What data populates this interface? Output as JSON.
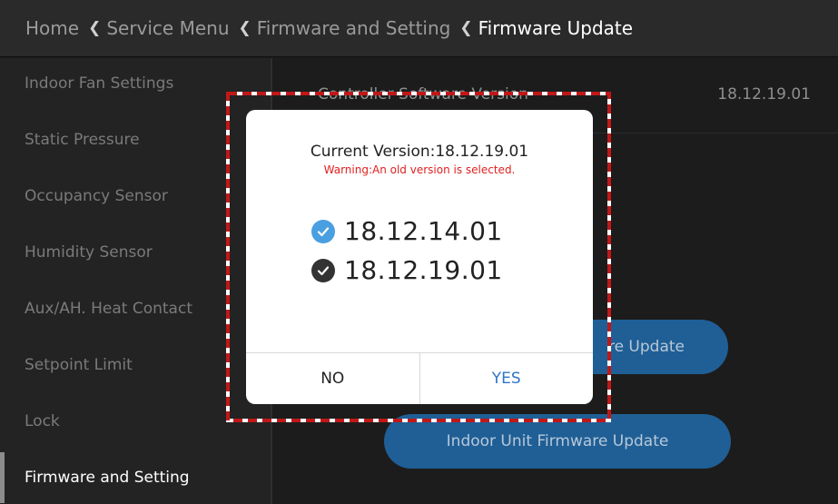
{
  "breadcrumb": [
    {
      "label": "Home"
    },
    {
      "label": "Service Menu"
    },
    {
      "label": "Firmware and Setting"
    },
    {
      "label": "Firmware Update"
    }
  ],
  "sidebar": {
    "items": [
      {
        "label": "Indoor Fan Settings"
      },
      {
        "label": "Static Pressure"
      },
      {
        "label": "Occupancy Sensor"
      },
      {
        "label": "Humidity Sensor"
      },
      {
        "label": "Aux/AH. Heat Contact"
      },
      {
        "label": "Setpoint Limit"
      },
      {
        "label": "Lock"
      },
      {
        "label": "Firmware and Setting"
      }
    ],
    "active_index": 7
  },
  "main": {
    "controller_label": "Controller Software Version",
    "controller_value": "18.12.19.01",
    "firmware_update_button": "re Update",
    "indoor_unit_button": "Indoor Unit Firmware Update"
  },
  "dialog": {
    "title": "Current Version:18.12.19.01",
    "warning": "Warning:An old version is selected.",
    "versions": [
      {
        "label": "18.12.14.01",
        "selected": true
      },
      {
        "label": "18.12.19.01",
        "selected": false
      }
    ],
    "no_label": "NO",
    "yes_label": "YES"
  },
  "colors": {
    "selected_check": "#4a9fe0",
    "unselected_check": "#333333",
    "warning": "#e02020",
    "yes": "#2f74c8",
    "pill": "#1f5f96",
    "highlight_frame": "#c01818"
  },
  "icons": {
    "breadcrumb_separator": "chevron-left-icon",
    "version_check": "check-circle-icon"
  }
}
